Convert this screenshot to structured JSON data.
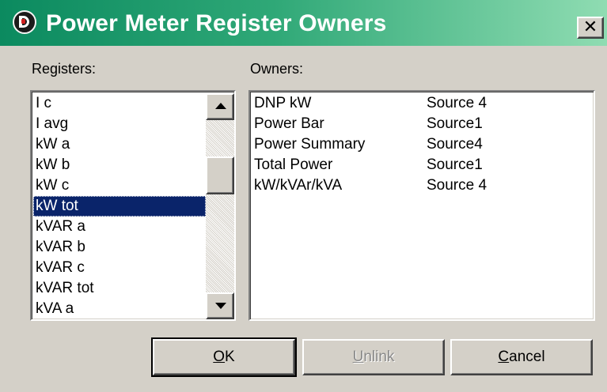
{
  "window": {
    "title": "Power Meter Register Owners",
    "close_glyph": "✕"
  },
  "registers": {
    "label": "Registers:",
    "items": [
      "I c",
      "I avg",
      "kW a",
      "kW b",
      "kW c",
      "kW tot",
      "kVAR a",
      "kVAR b",
      "kVAR c",
      "kVAR tot",
      "kVA a"
    ],
    "selected": "kW tot"
  },
  "owners": {
    "label": "Owners:",
    "rows": [
      {
        "name": "DNP kW",
        "source": "Source 4"
      },
      {
        "name": "Power Bar",
        "source": "Source1"
      },
      {
        "name": "Power Summary",
        "source": "Source4"
      },
      {
        "name": "Total Power",
        "source": "Source1"
      },
      {
        "name": "kW/kVAr/kVA",
        "source": "Source 4"
      }
    ]
  },
  "buttons": {
    "ok": {
      "mnemonic": "O",
      "rest": "K"
    },
    "unlink": {
      "mnemonic": "U",
      "rest": "nlink",
      "disabled": true
    },
    "cancel": {
      "mnemonic": "C",
      "rest": "ancel"
    }
  },
  "icons": {
    "app": "app-logo-icon",
    "close": "close-icon",
    "scroll_up": "arrow-up-icon",
    "scroll_down": "arrow-down-icon"
  },
  "colors": {
    "title_gradient_start": "#0b8a5f",
    "title_gradient_end": "#8fdcb2",
    "selection": "#0a246a",
    "face": "#d4d0c8"
  }
}
